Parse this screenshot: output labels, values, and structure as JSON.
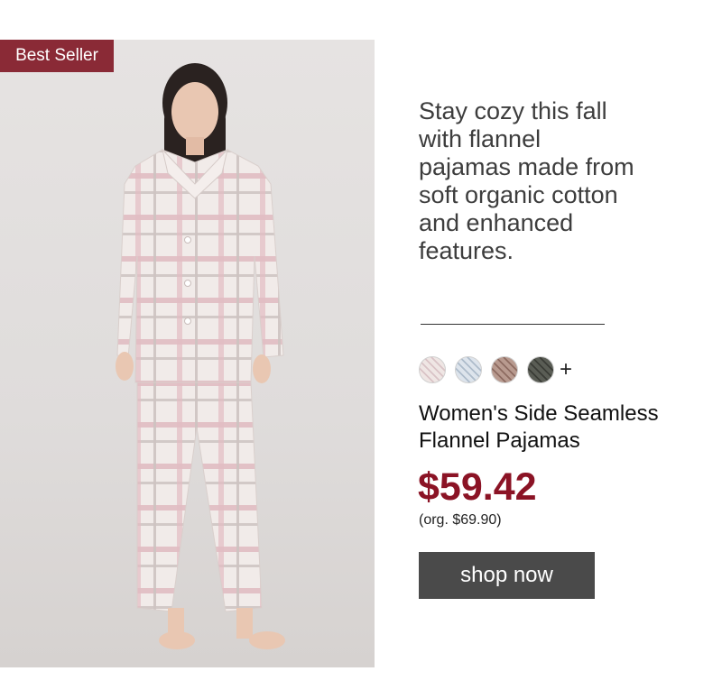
{
  "badge": {
    "label": "Best Seller",
    "color": "#8a2a36"
  },
  "promo": {
    "tagline": "Stay cozy this fall with flannel pajamas made from soft organic cotton and enhanced features."
  },
  "product": {
    "name": "Women's Side Seamless Flannel Pajamas",
    "price": "$59.42",
    "original_price": "(org. $69.90)",
    "price_color": "#8b1325"
  },
  "swatches": {
    "colors": [
      "#e6d9d7",
      "#c9d4df",
      "#a98a7e",
      "#4d5048"
    ],
    "more_label": "+"
  },
  "cta": {
    "label": "shop now"
  }
}
